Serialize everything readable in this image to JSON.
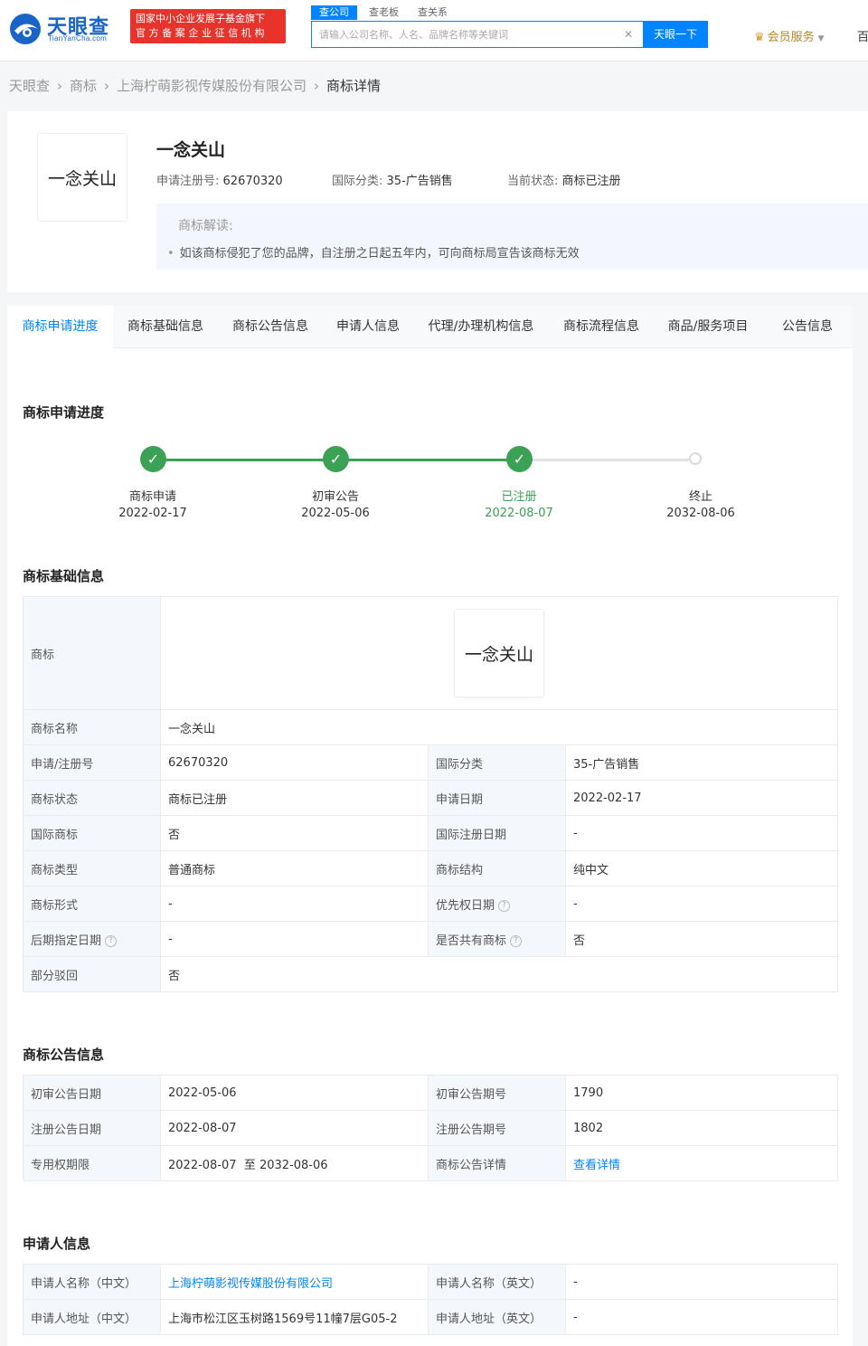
{
  "header": {
    "logo_cn": "天眼查",
    "logo_en": "TianYanCha.com",
    "badge_line1": "国家中小企业发展子基金旗下",
    "badge_line2": "官方备案企业征信机构",
    "search_tabs": [
      "查公司",
      "查老板",
      "查关系"
    ],
    "search_placeholder": "请输入公司名称、人名、品牌名称等关键词",
    "search_button": "天眼一下",
    "vip_label": "会员服务",
    "edge_text": "百"
  },
  "breadcrumb": [
    "天眼查",
    "商标",
    "上海柠萌影视传媒股份有限公司",
    "商标详情"
  ],
  "trademark": {
    "name": "一念关山",
    "reg_no_label": "申请注册号:",
    "reg_no": "62670320",
    "class_label": "国际分类:",
    "class": "35-广告销售",
    "status_label": "当前状态:",
    "status": "商标已注册",
    "note_title": "商标解读:",
    "note_item": "如该商标侵犯了您的品牌，自注册之日起五年内，可向商标局宣告该商标无效"
  },
  "tabs": [
    "商标申请进度",
    "商标基础信息",
    "商标公告信息",
    "申请人信息",
    "代理/办理机构信息",
    "商标流程信息",
    "商品/服务项目",
    "公告信息"
  ],
  "progress": {
    "title": "商标申请进度",
    "steps": [
      {
        "label": "商标申请",
        "date": "2022-02-17"
      },
      {
        "label": "初审公告",
        "date": "2022-05-06"
      },
      {
        "label": "已注册",
        "date": "2022-08-07"
      },
      {
        "label": "终止",
        "date": "2032-08-06"
      }
    ]
  },
  "basic": {
    "title": "商标基础信息",
    "mark_label": "商标",
    "mark_name": "一念关山",
    "name_label": "商标名称",
    "name_value": "一念关山",
    "rows": [
      [
        "申请/注册号",
        "62670320",
        "国际分类",
        "35-广告销售"
      ],
      [
        "商标状态",
        "商标已注册",
        "申请日期",
        "2022-02-17"
      ],
      [
        "国际商标",
        "否",
        "国际注册日期",
        "-"
      ],
      [
        "商标类型",
        "普通商标",
        "商标结构",
        "纯中文"
      ],
      [
        "商标形式",
        "-",
        "优先权日期",
        "-"
      ],
      [
        "后期指定日期",
        "-",
        "是否共有商标",
        "否"
      ]
    ],
    "reject_label": "部分驳回",
    "reject_value": "否"
  },
  "announce": {
    "title": "商标公告信息",
    "rows": [
      [
        "初审公告日期",
        "2022-05-06",
        "初审公告期号",
        "1790"
      ],
      [
        "注册公告日期",
        "2022-08-07",
        "注册公告期号",
        "1802"
      ],
      [
        "专用权期限",
        "2022-08-07  至 2032-08-06",
        "商标公告详情",
        "查看详情"
      ]
    ]
  },
  "applicant": {
    "title": "申请人信息",
    "rows": [
      [
        "申请人名称（中文）",
        "上海柠萌影视传媒股份有限公司",
        "申请人名称（英文）",
        "-"
      ],
      [
        "申请人地址（中文）",
        "上海市松江区玉树路1569号11幢7层G05-2",
        "申请人地址（英文）",
        "-"
      ]
    ]
  },
  "colors": {
    "brand_blue": "#0084ff",
    "logo_blue": "#1a63c7",
    "badge_red": "#e8322c",
    "success_green": "#3aa155",
    "vip_gold": "#b8862b"
  },
  "icons": {
    "logo": "tianyancha-eye-icon",
    "vip": "crown-icon",
    "step_done": "check-icon",
    "help": "question-circle-icon",
    "clear": "close-icon"
  }
}
